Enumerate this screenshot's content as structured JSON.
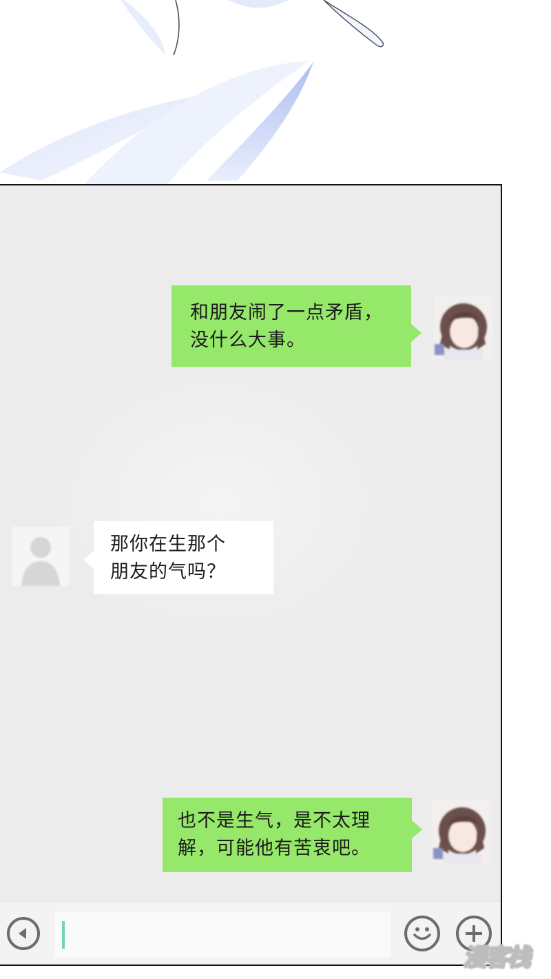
{
  "messages": [
    {
      "side": "right",
      "lines": [
        "和朋友闹了一点矛盾，",
        "没什么大事。"
      ]
    },
    {
      "side": "left",
      "lines": [
        "那你在生那个",
        "朋友的气吗？"
      ]
    },
    {
      "side": "right",
      "lines": [
        "也不是生气，是不太理",
        "解，可能他有苦衷吧。"
      ]
    }
  ],
  "input_bar": {
    "voice_icon": "speaker-icon",
    "emoji_icon": "smiley-icon",
    "more_icon": "plus-icon",
    "input_value": ""
  },
  "watermark": {
    "text": "漫客栈"
  },
  "colors": {
    "sent_bubble": "#96e86a",
    "received_bubble": "#ffffff",
    "chat_background": "#ececec",
    "caret": "#6fd6b2"
  }
}
